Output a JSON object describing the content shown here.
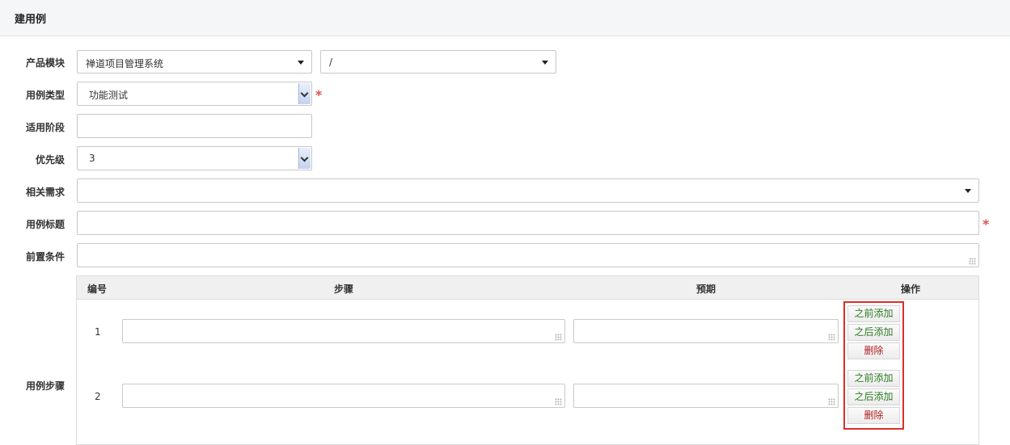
{
  "header": {
    "title": "建用例"
  },
  "form": {
    "product_module": {
      "label": "产品模块",
      "product_value": "禅道项目管理系统",
      "module_value": "/"
    },
    "case_type": {
      "label": "用例类型",
      "value": "功能测试",
      "required_mark": "*"
    },
    "stage": {
      "label": "适用阶段",
      "value": ""
    },
    "priority": {
      "label": "优先级",
      "value": "3"
    },
    "story": {
      "label": "相关需求",
      "value": ""
    },
    "title": {
      "label": "用例标题",
      "value": "",
      "required_mark": "*"
    },
    "precondition": {
      "label": "前置条件",
      "value": ""
    }
  },
  "steps": {
    "label": "用例步骤",
    "columns": {
      "num": "编号",
      "step": "步骤",
      "expect": "预期",
      "action": "操作"
    },
    "rows": [
      {
        "num": "1",
        "step": "",
        "expect": "",
        "add_before": "之前添加",
        "add_after": "之后添加",
        "delete": "删除"
      },
      {
        "num": "2",
        "step": "",
        "expect": "",
        "add_before": "之前添加",
        "add_after": "之后添加",
        "delete": "删除"
      }
    ]
  },
  "colors": {
    "required": "#d9534f",
    "highlight_border": "#d9302a",
    "add_text": "#2e7d23",
    "delete_text": "#b01e1e"
  }
}
